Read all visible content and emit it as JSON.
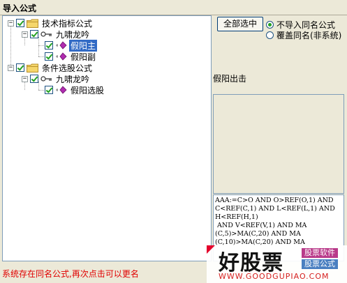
{
  "window": {
    "title": "导入公式"
  },
  "tree": {
    "nodes": [
      {
        "label": "技术指标公式",
        "expand": "−",
        "checked": true,
        "type": "folder"
      },
      {
        "label": "九啸龙吟",
        "expand": "−",
        "checked": true,
        "type": "key"
      },
      {
        "label": "假阳主",
        "checked": true,
        "type": "formula",
        "selected": true
      },
      {
        "label": "假阳副",
        "checked": true,
        "type": "formula"
      },
      {
        "label": "条件选股公式",
        "expand": "−",
        "checked": true,
        "type": "folder"
      },
      {
        "label": "九啸龙吟",
        "expand": "−",
        "checked": true,
        "type": "key"
      },
      {
        "label": "假阳选股",
        "checked": true,
        "type": "formula"
      }
    ]
  },
  "controls": {
    "select_all_label": "全部选中",
    "radio_no_import": "不导入同名公式",
    "radio_no_import_checked": true,
    "radio_overwrite": "覆盖同名(非系统)",
    "radio_overwrite_checked": false
  },
  "detail": {
    "formula_name": "假阳出击",
    "code": "AAA:=C>O AND O>REF(O,1) AND\nC<REF(C,1) AND L<REF(L,1) AND\nH<REF(H,1)\n AND V<REF(V,1) AND MA\n(C,5)>MA(C,20) AND MA\n(C,10)>MA(C,20) AND MA"
  },
  "status_text": "系统存在同名公式,再次点击可以更名",
  "watermark": {
    "logo": "好股票",
    "tag1": "股票软件",
    "tag2": "股票公式",
    "url": "WWW.GOODGUPIAO.COM"
  }
}
